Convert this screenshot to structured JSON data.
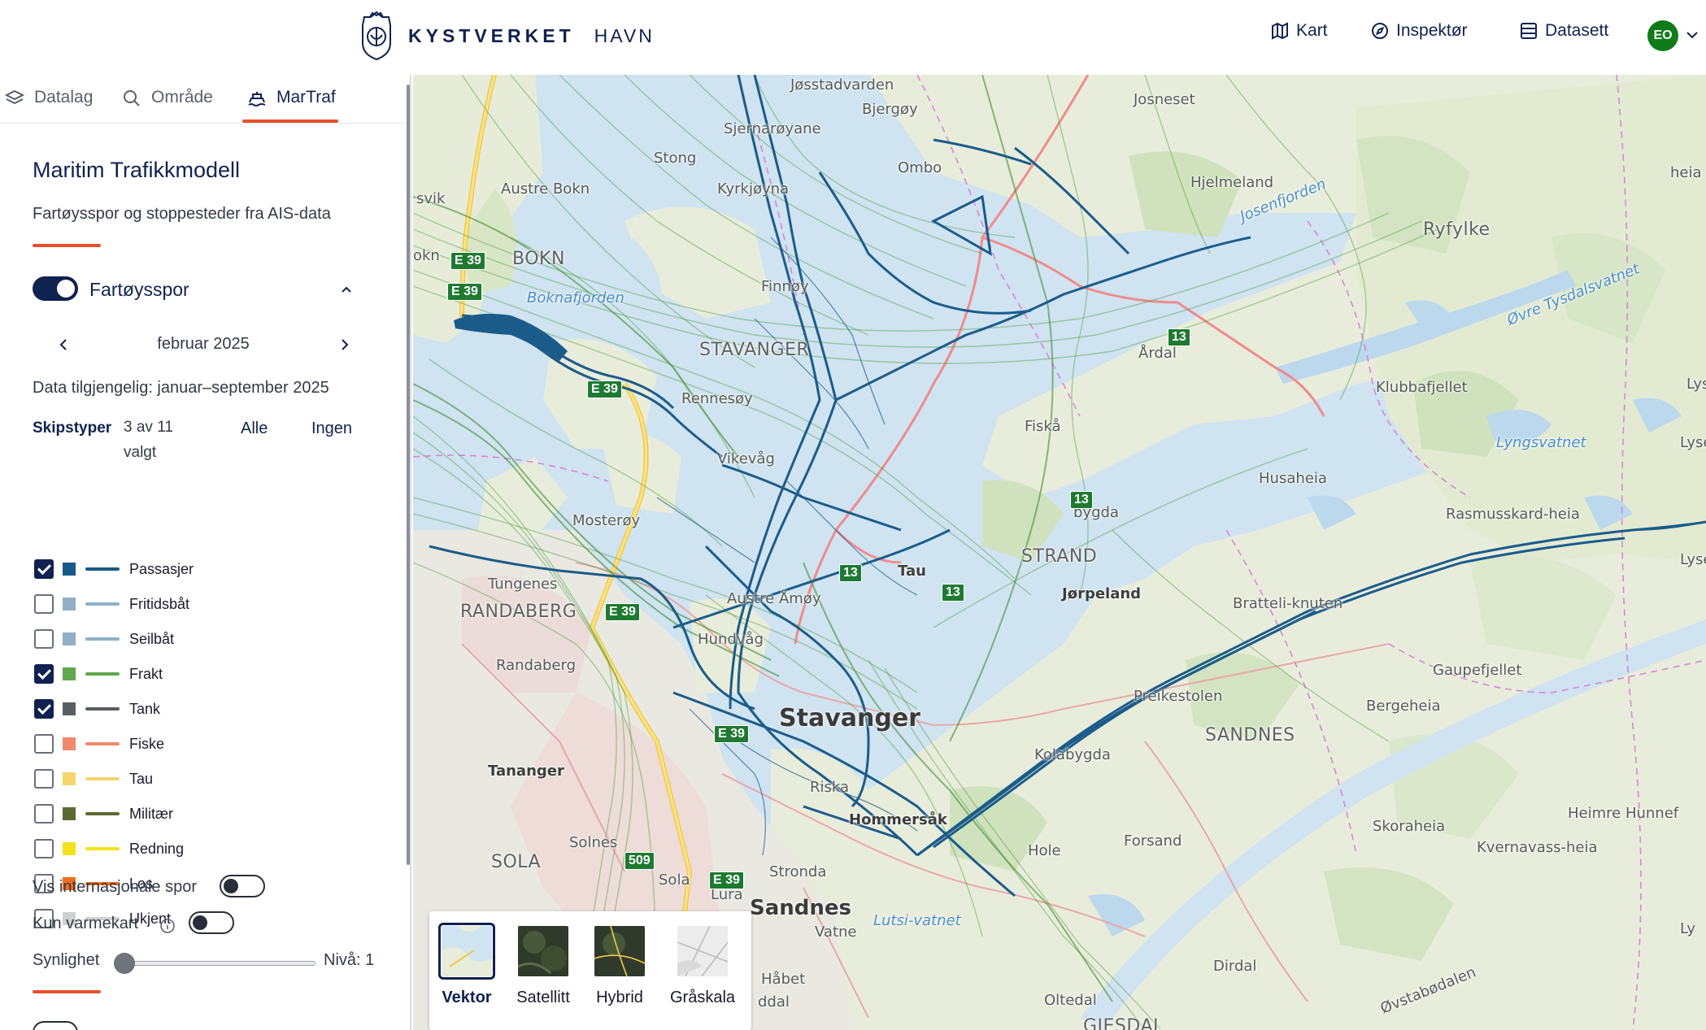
{
  "brand": {
    "name": "KYSTVERKET",
    "product": "HAVN"
  },
  "nav": [
    {
      "label": "Kart",
      "icon": "map-icon"
    },
    {
      "label": "Inspektør",
      "icon": "compass-icon"
    },
    {
      "label": "Datasett",
      "icon": "table-icon"
    }
  ],
  "user": {
    "initials": "EO",
    "color": "#0f7b1b"
  },
  "tabs": [
    {
      "label": "Datalag",
      "icon": "layers-icon",
      "active": false
    },
    {
      "label": "Område",
      "icon": "search-icon",
      "active": false
    },
    {
      "label": "MarTraf",
      "icon": "ship-icon",
      "active": true
    }
  ],
  "panel": {
    "title": "Maritim Trafikkmodell",
    "description": "Fartøysspor og stoppesteder fra AIS-data",
    "section_label": "Fartøysspor",
    "section_enabled": true,
    "month": "februar 2025",
    "availability": "Data tilgjengelig: januar–september 2025",
    "ship_types_label": "Skipstyper",
    "ship_types_count": "3 av 11 valgt",
    "select_all": "Alle",
    "select_none": "Ingen",
    "ship_types": [
      {
        "name": "Passasjer",
        "checked": true,
        "color": "#175a87"
      },
      {
        "name": "Fritidsbåt",
        "checked": false,
        "color": "#8fb0c8"
      },
      {
        "name": "Seilbåt",
        "checked": false,
        "color": "#8fb0c8"
      },
      {
        "name": "Frakt",
        "checked": true,
        "color": "#5fa84f"
      },
      {
        "name": "Tank",
        "checked": true,
        "color": "#5a5e63"
      },
      {
        "name": "Fiske",
        "checked": false,
        "color": "#ef8a6b"
      },
      {
        "name": "Tau",
        "checked": false,
        "color": "#f7d46d"
      },
      {
        "name": "Militær",
        "checked": false,
        "color": "#5b6a33"
      },
      {
        "name": "Redning",
        "checked": false,
        "color": "#f3e21c"
      },
      {
        "name": "Los",
        "checked": false,
        "color": "#f26d1c"
      },
      {
        "name": "Ukjent",
        "checked": false,
        "color": "#cfd0d2"
      }
    ],
    "intl_tracks_label": "Vis internasjonale spor",
    "intl_tracks_on": false,
    "heatmap_label": "Kun varmekart",
    "heatmap_on": false,
    "visibility_label": "Synlighet",
    "visibility_level_text": "Nivå: 1",
    "visibility_level": 1
  },
  "map": {
    "places": [
      "Jøsstadvarden",
      "Bjergøy",
      "Josneset",
      "Sjernarøyane",
      "Stong",
      "Ombo",
      "Kyrkjøyna",
      "Austre Bokn",
      "svik",
      "Hjelmeland",
      "heia",
      "Ryfylke",
      "okn",
      "BOKN",
      "Boknafjorden",
      "Finnøy",
      "Josenfjorden",
      "Øvre Tysdalsvatnet",
      "STAVANGER",
      "Årdal",
      "Klubbafjellet",
      "Rennesøy",
      "Fiskå",
      "Lyngsvatnet",
      "Vikevåg",
      "Husaheia",
      "Rasmusskard-heia",
      "bygda",
      "Mosterøy",
      "STRAND",
      "Tau",
      "Jørpeland",
      "Tungenes",
      "RANDABERG",
      "Bratteli-knuten",
      "Austre Åmøy",
      "Hundvåg",
      "Gaupefjellet",
      "Randaberg",
      "Preikestolen",
      "Bergeheia",
      "Stavanger",
      "SANDNES",
      "Kolabygda",
      "Tananger",
      "Riska",
      "Hommersåk",
      "Heimre Hunnef",
      "Skoraheia",
      "Kvernavass-heia",
      "Forsand",
      "Hole",
      "Solnes",
      "SOLA",
      "Sola",
      "Stronda",
      "Lura",
      "Sandnes",
      "Lutsi-vatnet",
      "Vatne",
      "Dirdal",
      "Håbet",
      "Oltedal",
      "Øvstabødalen",
      "ddal",
      "GJESDAL",
      "Lys",
      "Lyse",
      "Lysefjorden",
      "Ly"
    ],
    "roads": [
      "E 39",
      "13",
      "509"
    ],
    "basemaps": [
      {
        "label": "Vektor",
        "selected": true
      },
      {
        "label": "Satellitt",
        "selected": false
      },
      {
        "label": "Hybrid",
        "selected": false
      },
      {
        "label": "Gråskala",
        "selected": false
      }
    ]
  }
}
